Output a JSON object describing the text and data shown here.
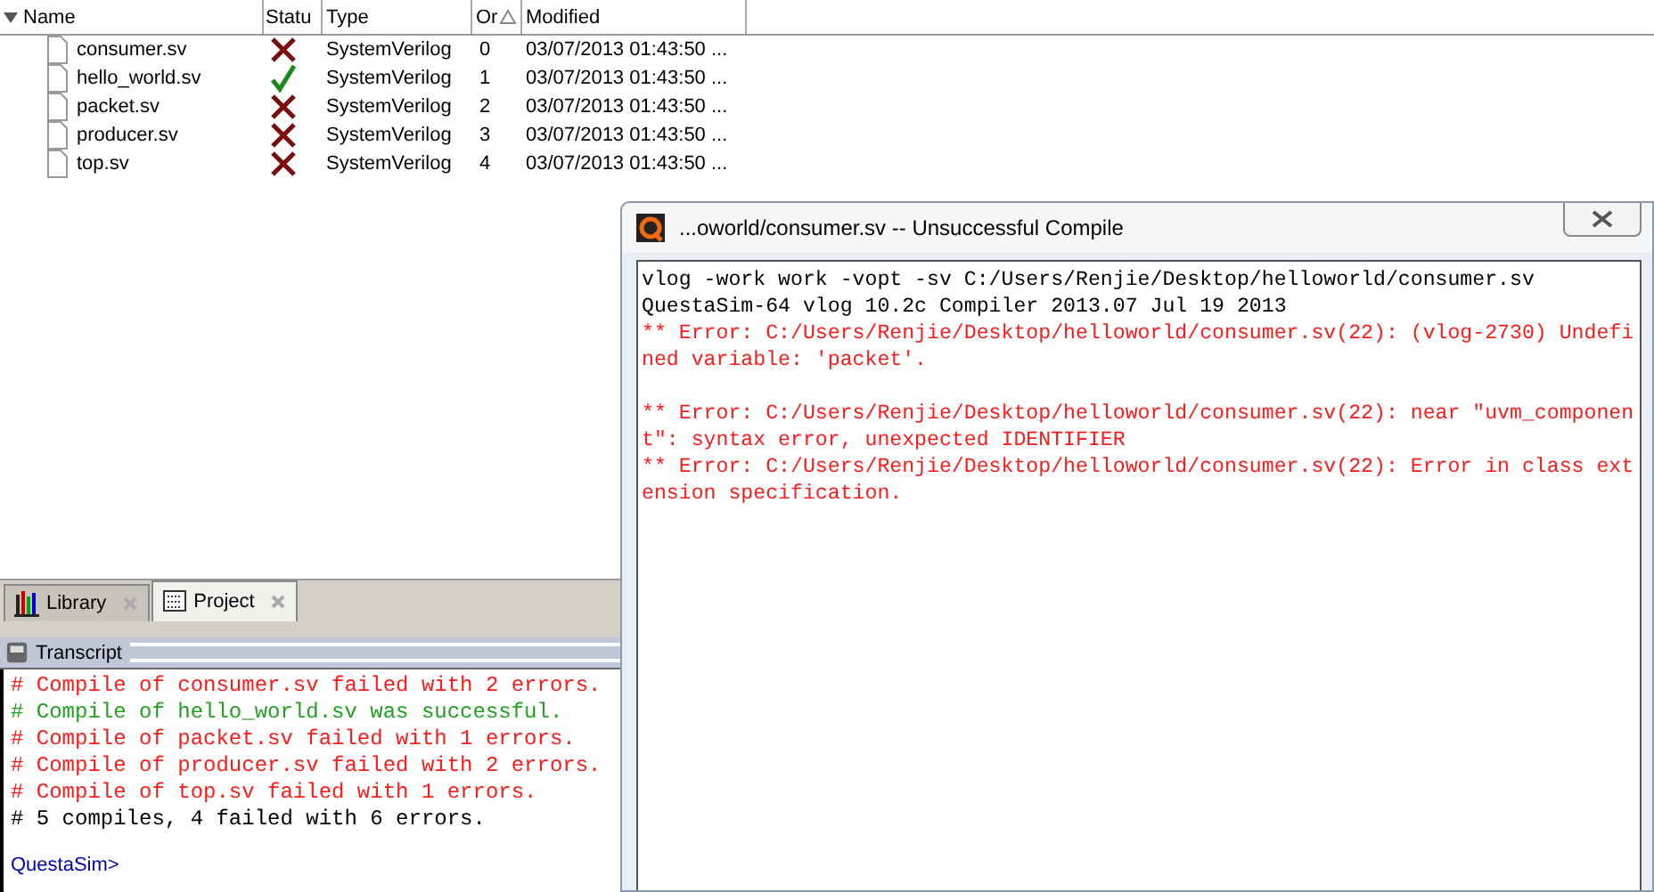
{
  "files": {
    "columns": [
      {
        "label": "Name",
        "sorted": false
      },
      {
        "label": "Statu",
        "sorted": false
      },
      {
        "label": "Type",
        "sorted": false
      },
      {
        "label": "Or",
        "sorted": true
      },
      {
        "label": "Modified",
        "sorted": false
      }
    ],
    "rows": [
      {
        "name": "consumer.sv",
        "failed": true,
        "type": "SystemVerilog",
        "order": "0",
        "modified": "03/07/2013 01:43:50 ..."
      },
      {
        "name": "hello_world.sv",
        "failed": false,
        "type": "SystemVerilog",
        "order": "1",
        "modified": "03/07/2013 01:43:50 ..."
      },
      {
        "name": "packet.sv",
        "failed": true,
        "type": "SystemVerilog",
        "order": "2",
        "modified": "03/07/2013 01:43:50 ..."
      },
      {
        "name": "producer.sv",
        "failed": true,
        "type": "SystemVerilog",
        "order": "3",
        "modified": "03/07/2013 01:43:50 ..."
      },
      {
        "name": "top.sv",
        "failed": true,
        "type": "SystemVerilog",
        "order": "4",
        "modified": "03/07/2013 01:43:50 ..."
      }
    ]
  },
  "tabs": [
    {
      "label": "Library",
      "selected": false
    },
    {
      "label": "Project",
      "selected": true
    }
  ],
  "transcript": {
    "title": "Transcript",
    "lines": [
      {
        "kind": "error",
        "text": "# Compile of consumer.sv failed with 2 errors."
      },
      {
        "kind": "success",
        "text": "# Compile of hello_world.sv was successful."
      },
      {
        "kind": "error",
        "text": "# Compile of packet.sv failed with 1 errors."
      },
      {
        "kind": "error",
        "text": "# Compile of producer.sv failed with 2 errors."
      },
      {
        "kind": "error",
        "text": "# Compile of top.sv failed with 1 errors."
      },
      {
        "kind": "normal",
        "text": "# 5 compiles, 4 failed with 6 errors."
      }
    ],
    "prompt": "QuestaSim>"
  },
  "dialog": {
    "title": "...oworld/consumer.sv  -- Unsuccessful Compile",
    "lines": [
      {
        "kind": "normal",
        "text": "vlog -work work -vopt -sv C:/Users/Renjie/Desktop/helloworld/consumer.sv"
      },
      {
        "kind": "normal",
        "text": "QuestaSim-64 vlog 10.2c Compiler 2013.07 Jul 19 2013"
      },
      {
        "kind": "error",
        "text": "** Error: C:/Users/Renjie/Desktop/helloworld/consumer.sv(22): (vlog-2730) Undefined variable: 'packet'."
      },
      {
        "kind": "blank"
      },
      {
        "kind": "error",
        "text": "** Error: C:/Users/Renjie/Desktop/helloworld/consumer.sv(22): near \"uvm_component\": syntax error, unexpected IDENTIFIER"
      },
      {
        "kind": "error",
        "text": "** Error: C:/Users/Renjie/Desktop/helloworld/consumer.sv(22): Error in class extension specification."
      }
    ]
  }
}
